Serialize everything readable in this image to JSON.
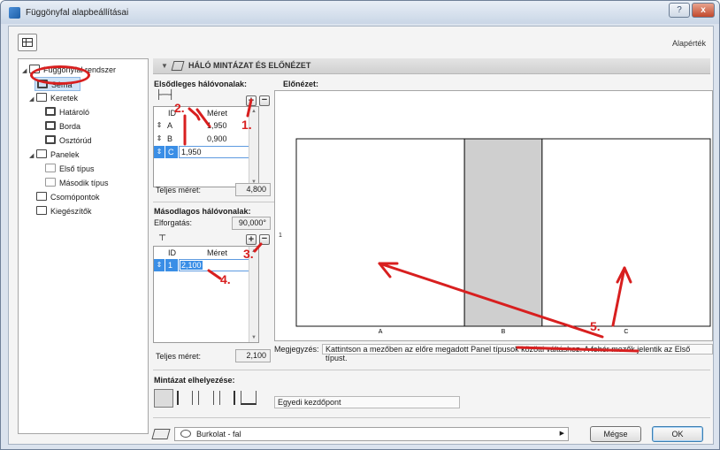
{
  "window": {
    "title": "Függönyfal alapbeállításai",
    "help_label": "?",
    "close_label": "x"
  },
  "toolbar": {
    "default_label": "Alapérték"
  },
  "tree": {
    "items": [
      {
        "label": "Függönyfal rendszer",
        "toggle": "◢",
        "icon": "curtain-wall-icon"
      },
      {
        "label": "Séma",
        "toggle": "",
        "icon": "grid-scheme-icon"
      },
      {
        "label": "Keretek",
        "toggle": "◢",
        "icon": "frames-icon"
      },
      {
        "label": "Határoló",
        "toggle": "",
        "icon": "boundary-frame-icon"
      },
      {
        "label": "Borda",
        "toggle": "",
        "icon": "mullion-icon"
      },
      {
        "label": "Osztórúd",
        "toggle": "",
        "icon": "transom-icon"
      },
      {
        "label": "Panelek",
        "toggle": "◢",
        "icon": "panels-icon"
      },
      {
        "label": "Első típus",
        "toggle": "",
        "icon": "panel-type-1-icon"
      },
      {
        "label": "Második típus",
        "toggle": "",
        "icon": "panel-type-2-icon"
      },
      {
        "label": "Csomópontok",
        "toggle": "",
        "icon": "junctions-icon"
      },
      {
        "label": "Kiegészítők",
        "toggle": "",
        "icon": "accessories-icon"
      }
    ]
  },
  "section": {
    "title": "HÁLÓ MINTÁZAT ÉS ELŐNÉZET"
  },
  "primary": {
    "title": "Elsődleges hálóvonalak:",
    "col_id": "ID",
    "col_size": "Méret",
    "rows": [
      {
        "handle": "⇕",
        "id": "A",
        "value": "1,950"
      },
      {
        "handle": "⇕",
        "id": "B",
        "value": "0,900"
      },
      {
        "handle": "⇕",
        "id": "C",
        "value": "1,950"
      }
    ],
    "total_label": "Teljes méret:",
    "total_value": "4,800"
  },
  "secondary": {
    "title": "Másodlagos hálóvonalak:",
    "rotation_label": "Elforgatás:",
    "rotation_value": "90,000°",
    "col_id": "ID",
    "col_size": "Méret",
    "rows": [
      {
        "handle": "⇕",
        "id": "1",
        "value": "2,100"
      }
    ],
    "total_label": "Teljes méret:",
    "total_value": "2,100"
  },
  "preview": {
    "title": "Előnézet:",
    "row_label": "1",
    "columns": [
      {
        "label": "A",
        "size": 1.95,
        "fill": "#ffffff"
      },
      {
        "label": "B",
        "size": 0.9,
        "fill": "#cfcfcf"
      },
      {
        "label": "C",
        "size": 1.95,
        "fill": "#ffffff"
      }
    ]
  },
  "note": {
    "prefix": "Megjegyzés:",
    "text": "Kattintson a mezőben az előre megadott Panel típusok közötti váltáshoz. A fehér mezők jelentik az Első típust."
  },
  "placement": {
    "title": "Mintázat elhelyezése:",
    "value": "Egyedi kezdőpont",
    "icons": [
      "placement-left-icon",
      "placement-center-icon",
      "placement-right-icon",
      "placement-fill-icon",
      "placement-custom-icon"
    ]
  },
  "footer": {
    "dropdown_value": "Burkolat - fal",
    "cancel_label": "Mégse",
    "ok_label": "OK"
  },
  "annotations": [
    "1.",
    "2.",
    "3.",
    "4.",
    "5."
  ],
  "colors": {
    "annotation_red": "#d81f1f",
    "selection_blue": "#3a8ee6",
    "panel_grey": "#cfcfcf"
  }
}
